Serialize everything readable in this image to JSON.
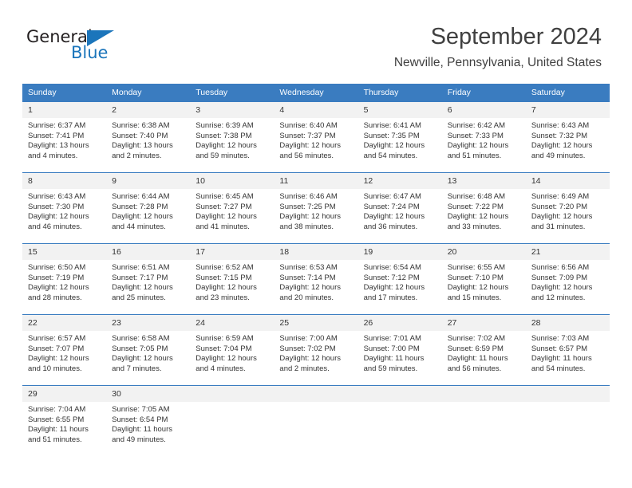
{
  "brand": {
    "name_part1": "General",
    "name_part2": "Blue",
    "triangle_icon": "triangle-icon",
    "accent_color": "#1b75bb"
  },
  "header": {
    "title": "September 2024",
    "location": "Newville, Pennsylvania, United States"
  },
  "calendar": {
    "header_bg": "#3a7cc0",
    "daynum_bg": "#f2f2f2",
    "weekday_headers": [
      "Sunday",
      "Monday",
      "Tuesday",
      "Wednesday",
      "Thursday",
      "Friday",
      "Saturday"
    ],
    "weeks": [
      [
        {
          "day": "1",
          "sunrise": "Sunrise: 6:37 AM",
          "sunset": "Sunset: 7:41 PM",
          "daylight_line1": "Daylight: 13 hours",
          "daylight_line2": "and 4 minutes."
        },
        {
          "day": "2",
          "sunrise": "Sunrise: 6:38 AM",
          "sunset": "Sunset: 7:40 PM",
          "daylight_line1": "Daylight: 13 hours",
          "daylight_line2": "and 2 minutes."
        },
        {
          "day": "3",
          "sunrise": "Sunrise: 6:39 AM",
          "sunset": "Sunset: 7:38 PM",
          "daylight_line1": "Daylight: 12 hours",
          "daylight_line2": "and 59 minutes."
        },
        {
          "day": "4",
          "sunrise": "Sunrise: 6:40 AM",
          "sunset": "Sunset: 7:37 PM",
          "daylight_line1": "Daylight: 12 hours",
          "daylight_line2": "and 56 minutes."
        },
        {
          "day": "5",
          "sunrise": "Sunrise: 6:41 AM",
          "sunset": "Sunset: 7:35 PM",
          "daylight_line1": "Daylight: 12 hours",
          "daylight_line2": "and 54 minutes."
        },
        {
          "day": "6",
          "sunrise": "Sunrise: 6:42 AM",
          "sunset": "Sunset: 7:33 PM",
          "daylight_line1": "Daylight: 12 hours",
          "daylight_line2": "and 51 minutes."
        },
        {
          "day": "7",
          "sunrise": "Sunrise: 6:43 AM",
          "sunset": "Sunset: 7:32 PM",
          "daylight_line1": "Daylight: 12 hours",
          "daylight_line2": "and 49 minutes."
        }
      ],
      [
        {
          "day": "8",
          "sunrise": "Sunrise: 6:43 AM",
          "sunset": "Sunset: 7:30 PM",
          "daylight_line1": "Daylight: 12 hours",
          "daylight_line2": "and 46 minutes."
        },
        {
          "day": "9",
          "sunrise": "Sunrise: 6:44 AM",
          "sunset": "Sunset: 7:28 PM",
          "daylight_line1": "Daylight: 12 hours",
          "daylight_line2": "and 44 minutes."
        },
        {
          "day": "10",
          "sunrise": "Sunrise: 6:45 AM",
          "sunset": "Sunset: 7:27 PM",
          "daylight_line1": "Daylight: 12 hours",
          "daylight_line2": "and 41 minutes."
        },
        {
          "day": "11",
          "sunrise": "Sunrise: 6:46 AM",
          "sunset": "Sunset: 7:25 PM",
          "daylight_line1": "Daylight: 12 hours",
          "daylight_line2": "and 38 minutes."
        },
        {
          "day": "12",
          "sunrise": "Sunrise: 6:47 AM",
          "sunset": "Sunset: 7:24 PM",
          "daylight_line1": "Daylight: 12 hours",
          "daylight_line2": "and 36 minutes."
        },
        {
          "day": "13",
          "sunrise": "Sunrise: 6:48 AM",
          "sunset": "Sunset: 7:22 PM",
          "daylight_line1": "Daylight: 12 hours",
          "daylight_line2": "and 33 minutes."
        },
        {
          "day": "14",
          "sunrise": "Sunrise: 6:49 AM",
          "sunset": "Sunset: 7:20 PM",
          "daylight_line1": "Daylight: 12 hours",
          "daylight_line2": "and 31 minutes."
        }
      ],
      [
        {
          "day": "15",
          "sunrise": "Sunrise: 6:50 AM",
          "sunset": "Sunset: 7:19 PM",
          "daylight_line1": "Daylight: 12 hours",
          "daylight_line2": "and 28 minutes."
        },
        {
          "day": "16",
          "sunrise": "Sunrise: 6:51 AM",
          "sunset": "Sunset: 7:17 PM",
          "daylight_line1": "Daylight: 12 hours",
          "daylight_line2": "and 25 minutes."
        },
        {
          "day": "17",
          "sunrise": "Sunrise: 6:52 AM",
          "sunset": "Sunset: 7:15 PM",
          "daylight_line1": "Daylight: 12 hours",
          "daylight_line2": "and 23 minutes."
        },
        {
          "day": "18",
          "sunrise": "Sunrise: 6:53 AM",
          "sunset": "Sunset: 7:14 PM",
          "daylight_line1": "Daylight: 12 hours",
          "daylight_line2": "and 20 minutes."
        },
        {
          "day": "19",
          "sunrise": "Sunrise: 6:54 AM",
          "sunset": "Sunset: 7:12 PM",
          "daylight_line1": "Daylight: 12 hours",
          "daylight_line2": "and 17 minutes."
        },
        {
          "day": "20",
          "sunrise": "Sunrise: 6:55 AM",
          "sunset": "Sunset: 7:10 PM",
          "daylight_line1": "Daylight: 12 hours",
          "daylight_line2": "and 15 minutes."
        },
        {
          "day": "21",
          "sunrise": "Sunrise: 6:56 AM",
          "sunset": "Sunset: 7:09 PM",
          "daylight_line1": "Daylight: 12 hours",
          "daylight_line2": "and 12 minutes."
        }
      ],
      [
        {
          "day": "22",
          "sunrise": "Sunrise: 6:57 AM",
          "sunset": "Sunset: 7:07 PM",
          "daylight_line1": "Daylight: 12 hours",
          "daylight_line2": "and 10 minutes."
        },
        {
          "day": "23",
          "sunrise": "Sunrise: 6:58 AM",
          "sunset": "Sunset: 7:05 PM",
          "daylight_line1": "Daylight: 12 hours",
          "daylight_line2": "and 7 minutes."
        },
        {
          "day": "24",
          "sunrise": "Sunrise: 6:59 AM",
          "sunset": "Sunset: 7:04 PM",
          "daylight_line1": "Daylight: 12 hours",
          "daylight_line2": "and 4 minutes."
        },
        {
          "day": "25",
          "sunrise": "Sunrise: 7:00 AM",
          "sunset": "Sunset: 7:02 PM",
          "daylight_line1": "Daylight: 12 hours",
          "daylight_line2": "and 2 minutes."
        },
        {
          "day": "26",
          "sunrise": "Sunrise: 7:01 AM",
          "sunset": "Sunset: 7:00 PM",
          "daylight_line1": "Daylight: 11 hours",
          "daylight_line2": "and 59 minutes."
        },
        {
          "day": "27",
          "sunrise": "Sunrise: 7:02 AM",
          "sunset": "Sunset: 6:59 PM",
          "daylight_line1": "Daylight: 11 hours",
          "daylight_line2": "and 56 minutes."
        },
        {
          "day": "28",
          "sunrise": "Sunrise: 7:03 AM",
          "sunset": "Sunset: 6:57 PM",
          "daylight_line1": "Daylight: 11 hours",
          "daylight_line2": "and 54 minutes."
        }
      ],
      [
        {
          "day": "29",
          "sunrise": "Sunrise: 7:04 AM",
          "sunset": "Sunset: 6:55 PM",
          "daylight_line1": "Daylight: 11 hours",
          "daylight_line2": "and 51 minutes."
        },
        {
          "day": "30",
          "sunrise": "Sunrise: 7:05 AM",
          "sunset": "Sunset: 6:54 PM",
          "daylight_line1": "Daylight: 11 hours",
          "daylight_line2": "and 49 minutes."
        },
        {
          "day": "",
          "sunrise": "",
          "sunset": "",
          "daylight_line1": "",
          "daylight_line2": ""
        },
        {
          "day": "",
          "sunrise": "",
          "sunset": "",
          "daylight_line1": "",
          "daylight_line2": ""
        },
        {
          "day": "",
          "sunrise": "",
          "sunset": "",
          "daylight_line1": "",
          "daylight_line2": ""
        },
        {
          "day": "",
          "sunrise": "",
          "sunset": "",
          "daylight_line1": "",
          "daylight_line2": ""
        },
        {
          "day": "",
          "sunrise": "",
          "sunset": "",
          "daylight_line1": "",
          "daylight_line2": ""
        }
      ]
    ]
  }
}
